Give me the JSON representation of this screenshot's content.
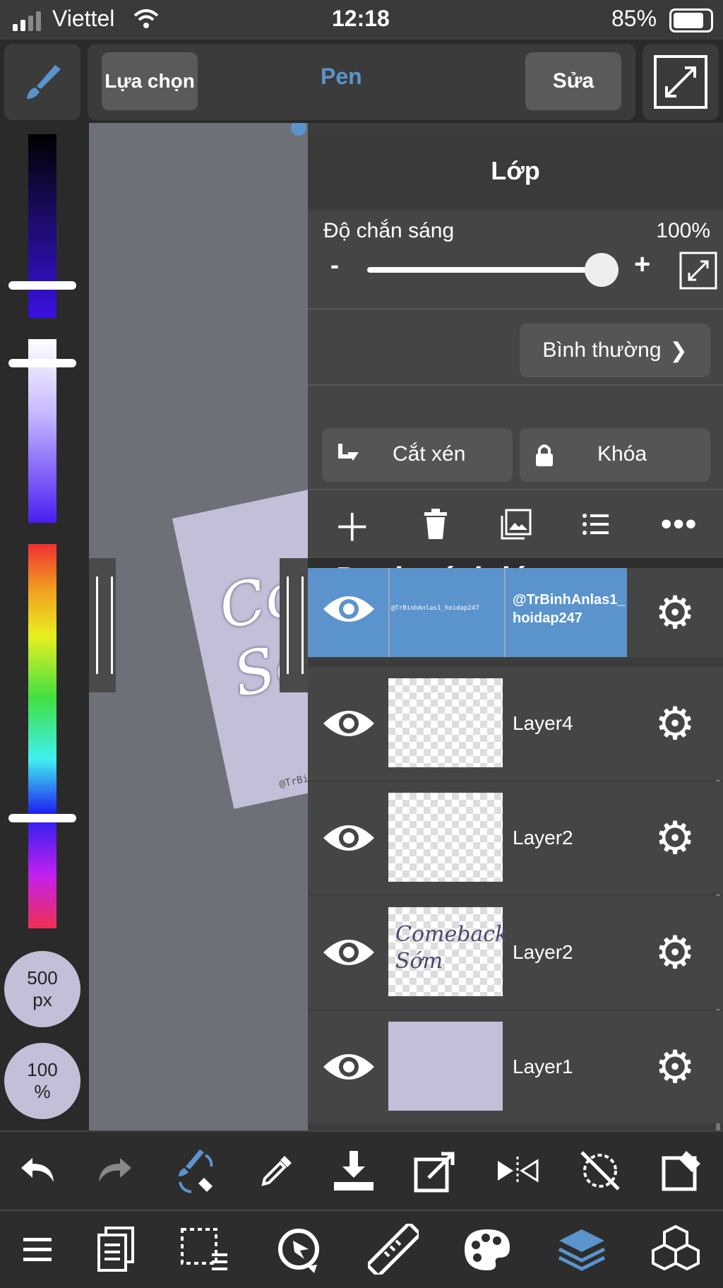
{
  "status": {
    "carrier": "Viettel",
    "time": "12:18",
    "battery": "85%"
  },
  "toolbar": {
    "select_label": "Lựa chọn",
    "tool_label": "Pen",
    "edit_label": "Sửa"
  },
  "brush": {
    "size": "500",
    "size_unit": "px",
    "opacity": "100",
    "opacity_unit": "%"
  },
  "layer_panel": {
    "title": "Lớp",
    "opacity_label": "Độ chắn sáng",
    "opacity_value": "100%",
    "minus": "-",
    "plus": "+",
    "opacity_level": 1.0,
    "blend_mode": "Bình thường",
    "clip_label": "Cắt xén",
    "lock_label": "Khóa",
    "list_title": "Danh sách lớp",
    "layers": [
      {
        "name": "@TrBinhAnlas1_hoidap247",
        "thumb_text": "@TrBinhAnlas1_hoidap247",
        "selected": true
      },
      {
        "name": "Layer4",
        "selected": false
      },
      {
        "name": "Layer2",
        "selected": false
      },
      {
        "name": "Layer2",
        "thumb_text": "Comeback Sớm",
        "selected": false
      },
      {
        "name": "Layer1",
        "selected": false
      }
    ]
  },
  "canvas": {
    "watermark": "@TrBinhAn"
  },
  "colors": {
    "accent": "#5b94cc",
    "panel": "#3c3c3c",
    "canvas_bg": "#6e7078",
    "paper": "#c2bfd8"
  },
  "icons": {
    "top": [
      "brush-icon",
      "fullscreen-icon"
    ],
    "bottom_row1": [
      "undo-icon",
      "redo-icon",
      "brush-eraser-swap-icon",
      "eyedropper-icon",
      "download-icon",
      "export-icon",
      "flip-icon",
      "rotate-lock-icon",
      "clear-icon"
    ],
    "bottom_row2": [
      "menu-icon",
      "pages-icon",
      "selection-icon",
      "transform-icon",
      "ruler-icon",
      "palette-icon",
      "layers-icon",
      "3d-icon"
    ]
  }
}
